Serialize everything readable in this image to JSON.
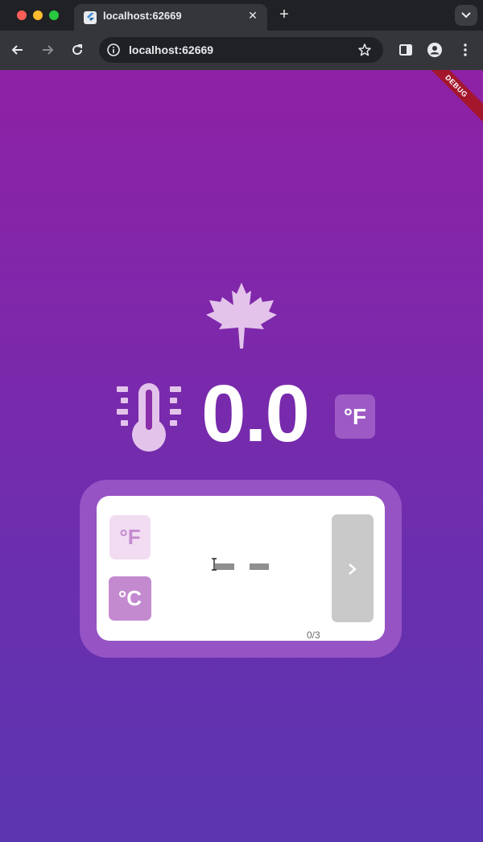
{
  "browser": {
    "tab_title": "localhost:62669",
    "url": "localhost:62669",
    "icons": {
      "back": "arrow-left-icon",
      "forward": "arrow-right-icon",
      "reload": "reload-icon",
      "site_info": "info-icon",
      "bookmark": "star-icon",
      "side_panel": "side-panel-icon",
      "profile": "profile-icon",
      "menu": "kebab-menu-icon",
      "new_tab": "plus-icon",
      "close_tab": "close-icon",
      "tab_search": "chevron-down-icon"
    }
  },
  "app": {
    "debug_banner": "DEBUG",
    "season_icon": "maple-leaf-icon",
    "thermometer_icon": "thermometer-icon",
    "temperature_value": "0.0",
    "current_unit": "°F",
    "converter": {
      "unit_fahrenheit_label": "°F",
      "unit_celsius_label": "°C",
      "selected_unit": "°C",
      "input_value": "",
      "char_counter": "0/3",
      "submit_icon": "chevron-right-icon"
    },
    "colors": {
      "gradient_top": "#8e21a5",
      "gradient_bottom": "#5b34b0",
      "panel_border": "#9553c4",
      "unit_badge": "#9d5ac4",
      "selected_unit_button": "#c48ad0",
      "unselected_unit_button": "#f1dcf1",
      "submit_button_disabled": "#c9c9c9"
    }
  }
}
